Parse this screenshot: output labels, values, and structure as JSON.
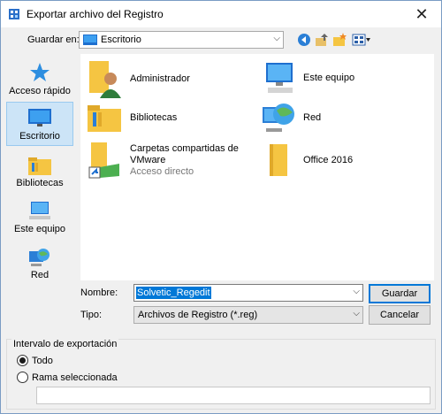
{
  "window": {
    "title": "Exportar archivo del Registro",
    "close_glyph": "✕"
  },
  "toolbar": {
    "save_in_label": "Guardar en:",
    "save_in_value": "Escritorio",
    "back_icon": "back-arrow-icon",
    "up_icon": "up-folder-icon",
    "new_folder_icon": "new-folder-icon",
    "view_icon": "view-menu-icon"
  },
  "places": [
    {
      "label": "Acceso rápido",
      "icon": "star-icon"
    },
    {
      "label": "Escritorio",
      "icon": "desktop-icon"
    },
    {
      "label": "Bibliotecas",
      "icon": "libraries-icon"
    },
    {
      "label": "Este equipo",
      "icon": "computer-icon"
    },
    {
      "label": "Red",
      "icon": "network-icon"
    }
  ],
  "files": [
    {
      "name": "Administrador",
      "icon": "user-folder-icon"
    },
    {
      "name": "Este equipo",
      "icon": "computer-icon"
    },
    {
      "name": "Bibliotecas",
      "icon": "libraries-icon"
    },
    {
      "name": "Red",
      "icon": "network-icon"
    },
    {
      "name": "Carpetas compartidas de",
      "name2": "VMware",
      "sub": "Acceso directo",
      "icon": "shared-folder-shortcut-icon"
    },
    {
      "name": "Office 2016",
      "icon": "folder-icon"
    }
  ],
  "form": {
    "name_label": "Nombre:",
    "name_value": "Solvetic_Regedit",
    "type_label": "Tipo:",
    "type_value": "Archivos de Registro (*.reg)",
    "save_button": "Guardar",
    "cancel_button": "Cancelar"
  },
  "export_range": {
    "title": "Intervalo de exportación",
    "option_all": "Todo",
    "option_branch": "Rama seleccionada",
    "selected": "Todo",
    "branch_value": ""
  },
  "colors": {
    "accent": "#0078d7",
    "selection_bg": "#cce4f7",
    "folder": "#f5c542"
  }
}
